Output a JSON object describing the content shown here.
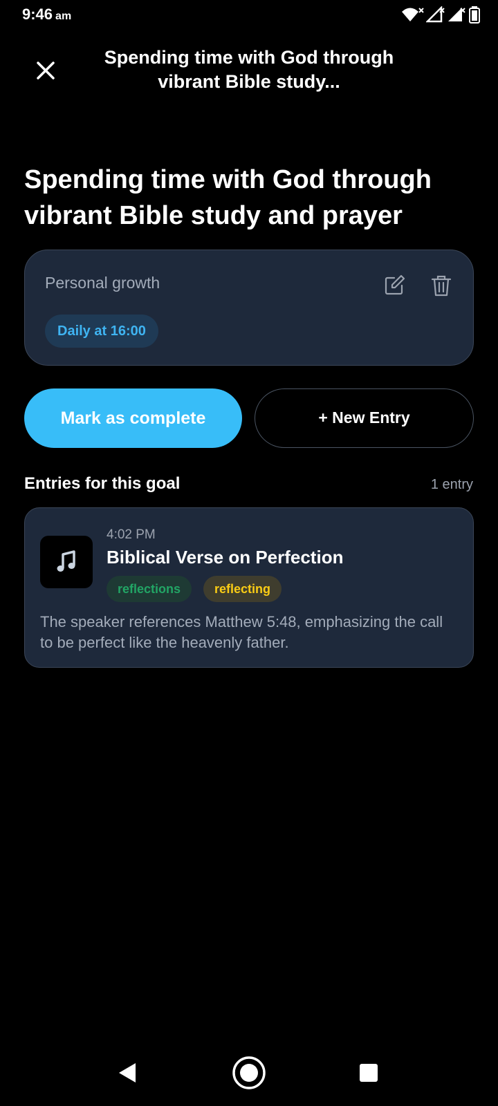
{
  "status_bar": {
    "time": "9:46",
    "ampm": "am",
    "icons": [
      "wifi-icon",
      "signal-icon",
      "signal-icon",
      "battery-icon"
    ]
  },
  "header": {
    "close_icon": "close-icon",
    "title": "Spending time with God through vibrant Bible study..."
  },
  "goal": {
    "title": "Spending time with God through vibrant Bible study and prayer",
    "category": "Personal growth",
    "schedule": "Daily at 16:00",
    "edit_icon": "edit-icon",
    "delete_icon": "trash-icon"
  },
  "actions": {
    "complete_label": "Mark as complete",
    "new_entry_label": "+ New Entry"
  },
  "entries": {
    "heading": "Entries for this goal",
    "count": "1 entry",
    "items": [
      {
        "time": "4:02 PM",
        "title": "Biblical Verse on Perfection",
        "icon": "music-note-icon",
        "tags": [
          "reflections",
          "reflecting"
        ],
        "summary": "The speaker references Matthew 5:48, emphasizing the call to be perfect like the heavenly father."
      }
    ]
  },
  "nav": {
    "back_icon": "back-icon",
    "home_icon": "home-icon",
    "recents_icon": "recents-icon"
  },
  "colors": {
    "accent": "#38bdf8",
    "card_bg": "#1e293b",
    "tag_green": "#22a565",
    "tag_yellow": "#facc15"
  }
}
